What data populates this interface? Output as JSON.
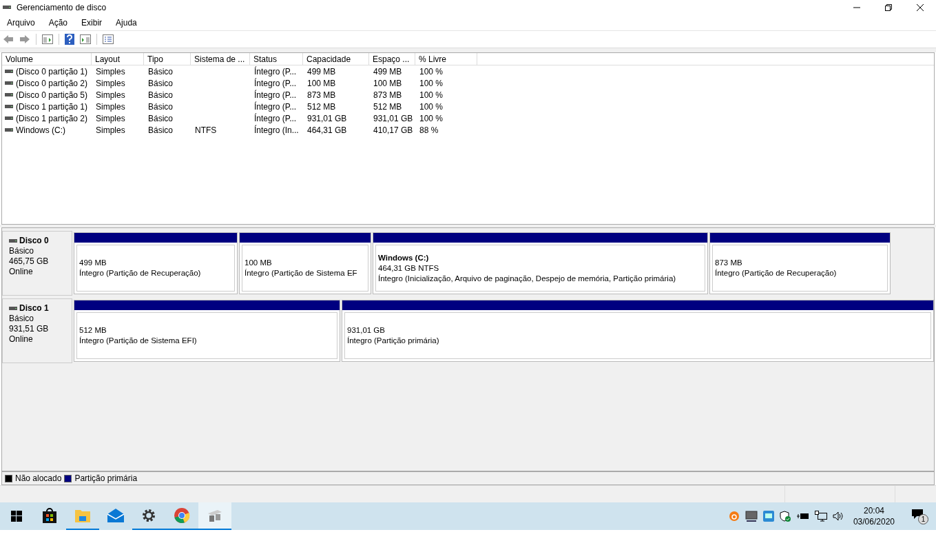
{
  "window": {
    "title": "Gerenciamento de disco"
  },
  "menu": [
    "Arquivo",
    "Ação",
    "Exibir",
    "Ajuda"
  ],
  "table": {
    "columns": [
      "Volume",
      "Layout",
      "Tipo",
      "Sistema de ...",
      "Status",
      "Capacidade",
      "Espaço ...",
      "% Livre"
    ],
    "rows": [
      [
        "(Disco 0 partição 1)",
        "Simples",
        "Básico",
        "",
        "Íntegro (P...",
        "499 MB",
        "499 MB",
        "100 %"
      ],
      [
        "(Disco 0 partição 2)",
        "Simples",
        "Básico",
        "",
        "Íntegro (P...",
        "100 MB",
        "100 MB",
        "100 %"
      ],
      [
        "(Disco 0 partição 5)",
        "Simples",
        "Básico",
        "",
        "Íntegro (P...",
        "873 MB",
        "873 MB",
        "100 %"
      ],
      [
        "(Disco 1 partição 1)",
        "Simples",
        "Básico",
        "",
        "Íntegro (P...",
        "512 MB",
        "512 MB",
        "100 %"
      ],
      [
        "(Disco 1 partição 2)",
        "Simples",
        "Básico",
        "",
        "Íntegro (P...",
        "931,01 GB",
        "931,01 GB",
        "100 %"
      ],
      [
        "Windows (C:)",
        "Simples",
        "Básico",
        "NTFS",
        "Íntegro (In...",
        "464,31 GB",
        "410,17 GB",
        "88 %"
      ]
    ]
  },
  "disks": [
    {
      "name": "Disco 0",
      "type": "Básico",
      "size": "465,75 GB",
      "status": "Online",
      "partitions": [
        {
          "size": "499 MB",
          "status": "Íntegro (Partição de Recuperação)"
        },
        {
          "size": "100 MB",
          "status": "Íntegro (Partição de Sistema EF"
        },
        {
          "label": "Windows  (C:)",
          "size": "464,31 GB NTFS",
          "status": "Íntegro (Inicialização, Arquivo de paginação, Despejo de memória, Partição primária)"
        },
        {
          "size": "873 MB",
          "status": "Íntegro (Partição de Recuperação)"
        }
      ]
    },
    {
      "name": "Disco 1",
      "type": "Básico",
      "size": "931,51 GB",
      "status": "Online",
      "partitions": [
        {
          "size": "512 MB",
          "status": "Íntegro (Partição de Sistema EFI)"
        },
        {
          "size": "931,01 GB",
          "status": "Íntegro (Partição primária)"
        }
      ]
    }
  ],
  "legend": [
    {
      "label": "Não alocado",
      "color": "#000000"
    },
    {
      "label": "Partição primária",
      "color": "#000080"
    }
  ],
  "taskbar": {
    "apps": [
      {
        "kind": "store",
        "running": false,
        "selected": false
      },
      {
        "kind": "folder",
        "running": true,
        "selected": false
      },
      {
        "kind": "mail",
        "running": false,
        "selected": false
      },
      {
        "kind": "gear",
        "running": true,
        "selected": false
      },
      {
        "kind": "browser",
        "running": true,
        "selected": false
      },
      {
        "kind": "disk",
        "running": true,
        "selected": true
      }
    ],
    "time": "20:04",
    "date": "03/06/2020",
    "notifications": "1"
  }
}
